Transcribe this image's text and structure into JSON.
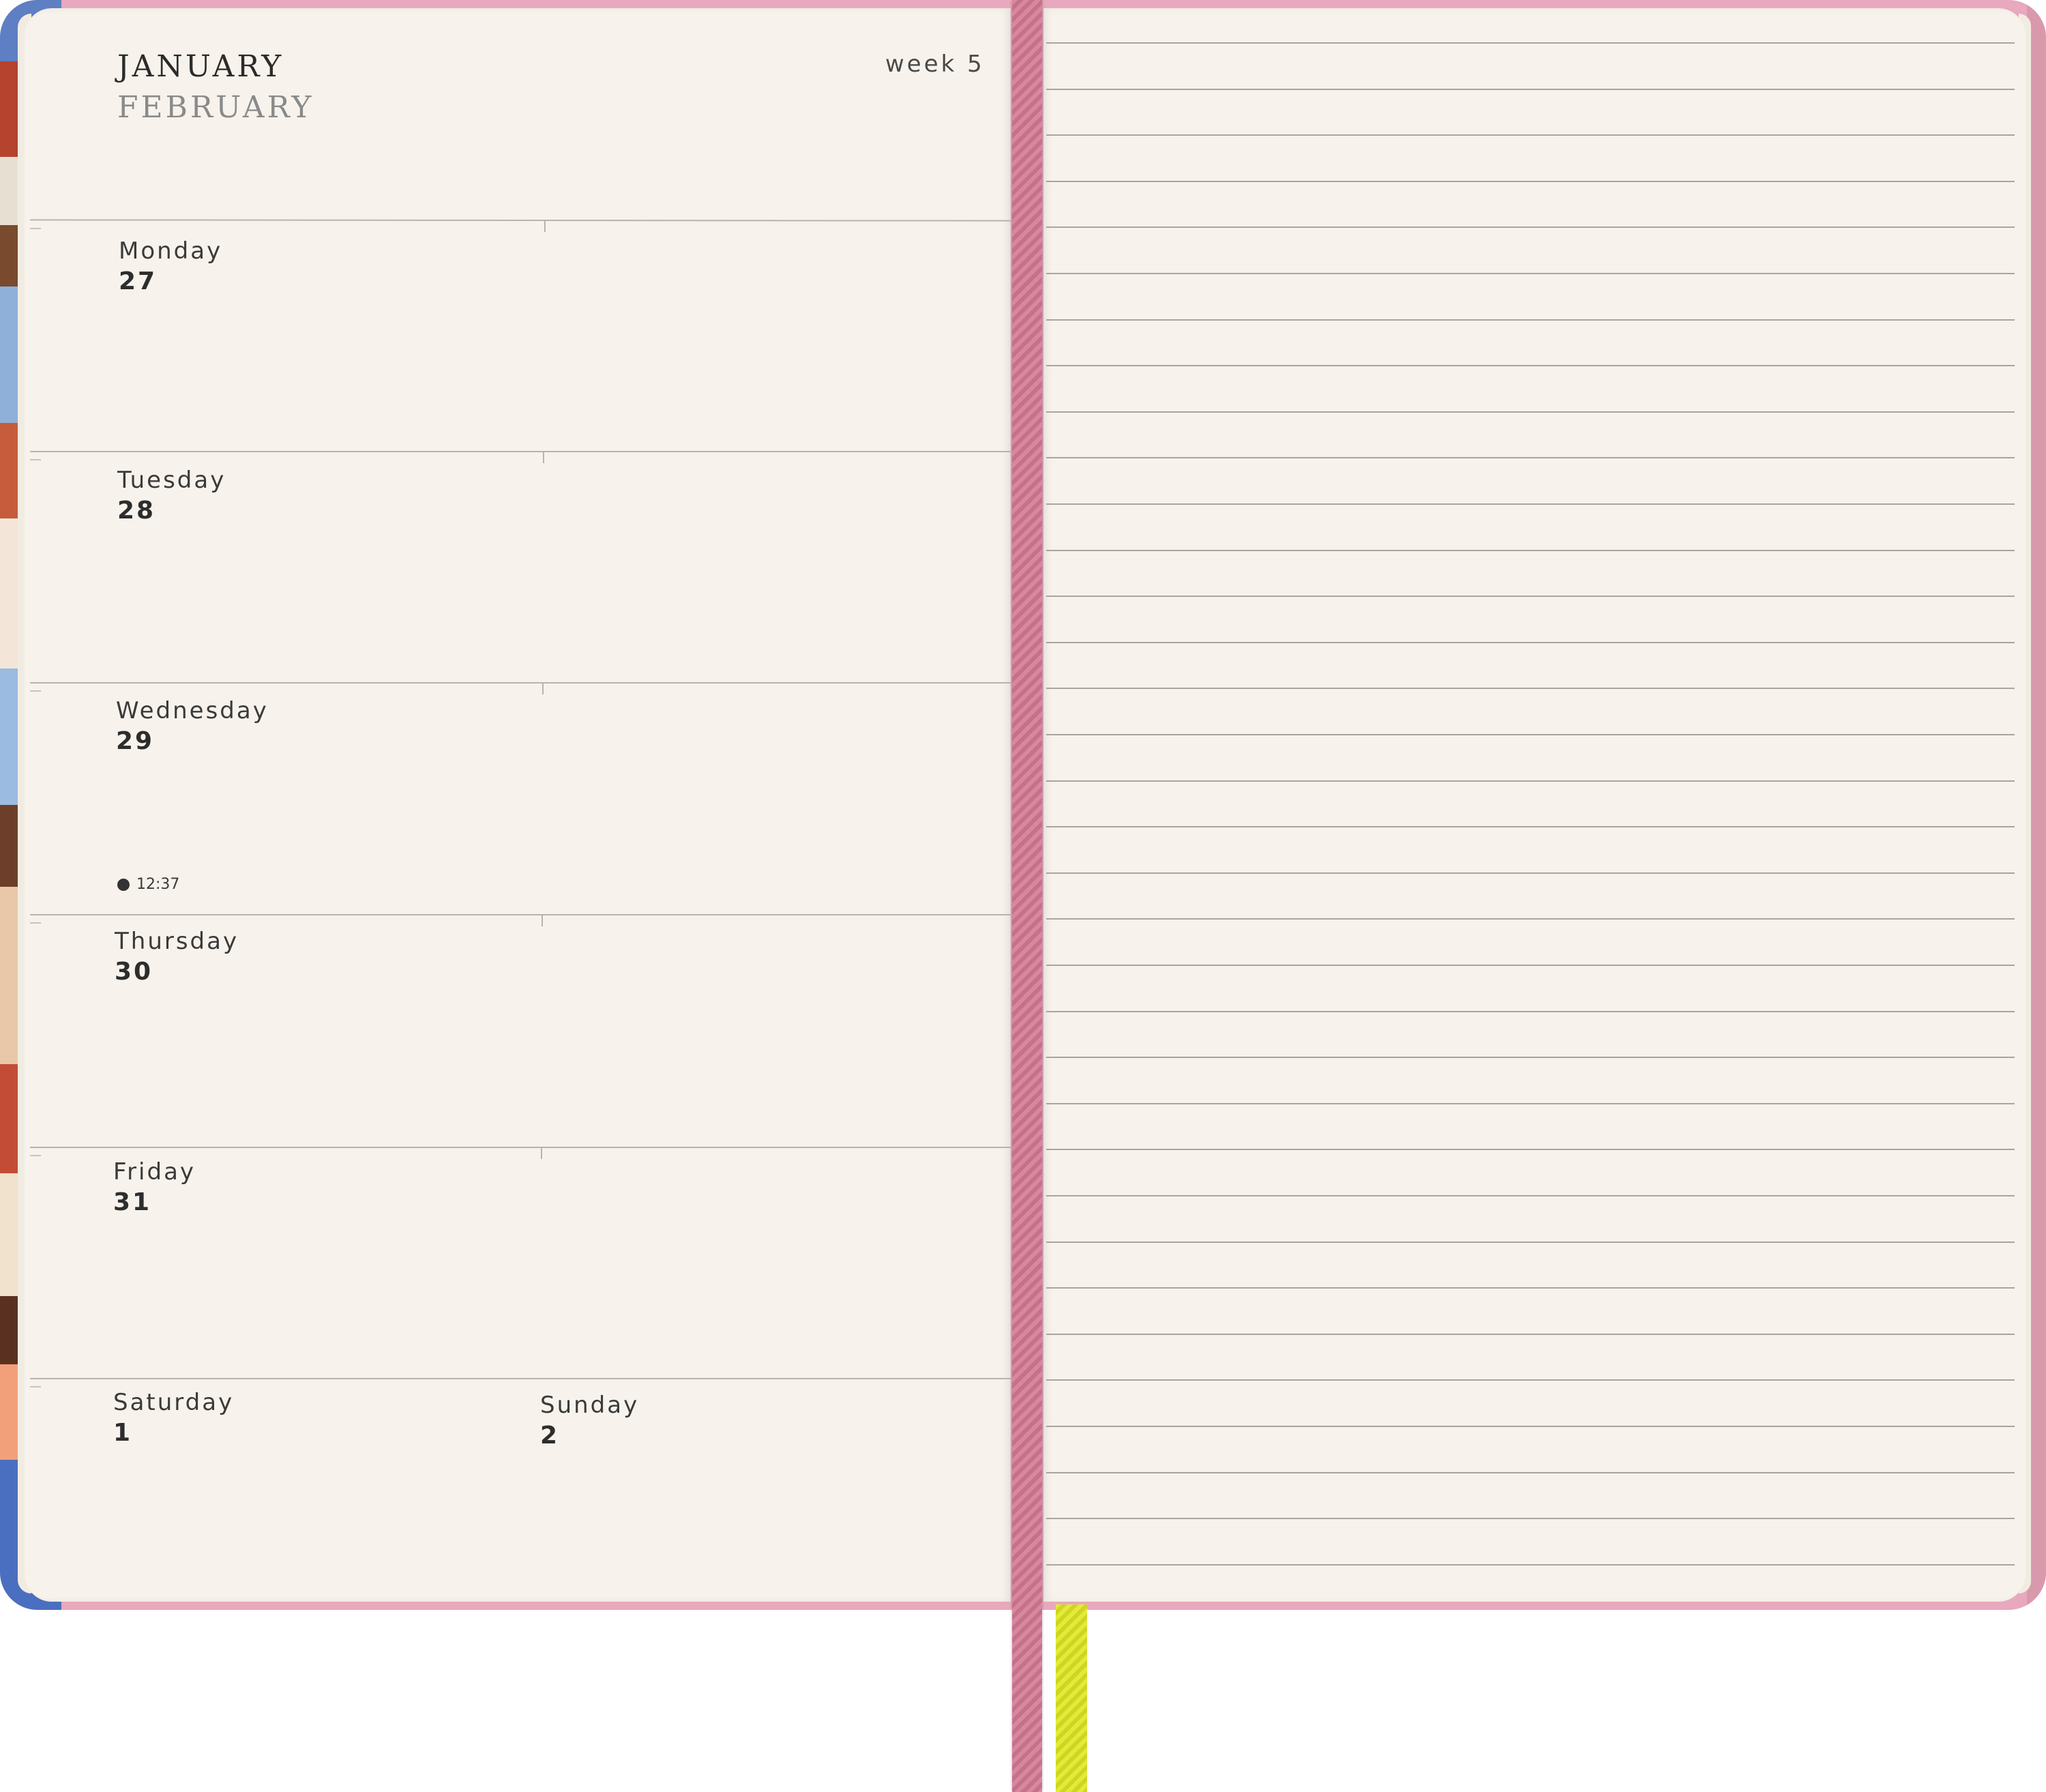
{
  "header": {
    "month_primary": "JANUARY",
    "month_secondary": "FEBRUARY",
    "week": "week 5"
  },
  "days": [
    {
      "name": "Monday",
      "number": "27"
    },
    {
      "name": "Tuesday",
      "number": "28"
    },
    {
      "name": "Wednesday",
      "number": "29",
      "moon_time": "12:37"
    },
    {
      "name": "Thursday",
      "number": "30"
    },
    {
      "name": "Friday",
      "number": "31"
    },
    {
      "name": "Saturday",
      "number": "1"
    },
    {
      "name": "Sunday",
      "number": "2"
    }
  ],
  "colors": {
    "cover": "#e8a8bd",
    "page": "#f7f3ec",
    "ribbon_pink": "#d9879f",
    "ribbon_yellow": "#e4ea3c"
  }
}
